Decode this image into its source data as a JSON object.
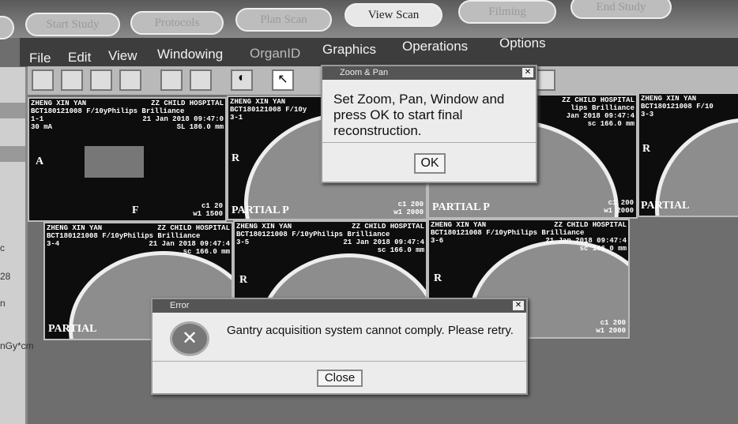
{
  "workflow": [
    "Start Study",
    "Protocols",
    "Plan Scan",
    "View Scan",
    "Filming",
    "End Study"
  ],
  "active_workflow": "View Scan",
  "menu": [
    "File",
    "Edit",
    "View",
    "Windowing",
    "OrganID",
    "Graphics",
    "Operations",
    "Options"
  ],
  "left_panel": [
    "c",
    "28",
    "n",
    "nGy*cm"
  ],
  "viewports": [
    {
      "name": "ZHENG XIN YAN",
      "hospital": "ZZ CHILD HOSPITAL",
      "id": "BCT180121008 F/10y",
      "scanner": "Philips Brilliance",
      "pos": "1-1",
      "date": "21 Jan 2018 09:47:0",
      "extra": "30 mA",
      "slice": "SL 186.0 mm",
      "left": "A",
      "bottom": "F",
      "wl": "c1 20",
      "ww": "w1 1500"
    },
    {
      "name": "ZHENG XIN YAN",
      "hospital": "",
      "id": "BCT180121008 F/10y",
      "scanner": "",
      "pos": "3-1",
      "date": "",
      "extra": "",
      "slice": "",
      "left": "R",
      "bottom": "PARTIAL   P",
      "wl": "c1 200",
      "ww": "w1 2000"
    },
    {
      "name": "",
      "hospital": "ZZ CHILD HOSPITAL",
      "id": "",
      "scanner": "lips Brilliance",
      "pos": "",
      "date": "Jan 2018 09:47:4",
      "extra": "",
      "slice": "sc 166.0 mm",
      "left": "",
      "bottom": "PARTIAL   P",
      "wl": "c1 200",
      "ww": "w1 2000"
    },
    {
      "name": "ZHENG XIN YAN",
      "hospital": "",
      "id": "BCT180121008 F/10",
      "scanner": "",
      "pos": "3-3",
      "date": "",
      "extra": "",
      "slice": "",
      "left": "R",
      "bottom": "PARTIAL",
      "wl": "",
      "ww": ""
    },
    {
      "name": "ZHENG XIN YAN",
      "hospital": "ZZ CHILD HOSPITAL",
      "id": "BCT180121008 F/10y",
      "scanner": "Philips Brilliance",
      "pos": "3-4",
      "date": "21 Jan 2018 09:47:4",
      "extra": "",
      "slice": "sc 166.0 mm",
      "left": "R",
      "bottom": "PARTIAL",
      "wl": "",
      "ww": ""
    },
    {
      "name": "ZHENG XIN YAN",
      "hospital": "ZZ CHILD HOSPITAL",
      "id": "BCT180121008 F/10y",
      "scanner": "Philips Brilliance",
      "pos": "3-5",
      "date": "21 Jan 2018 09:47:4",
      "extra": "",
      "slice": "sc 166.0 mm",
      "left": "R",
      "bottom": "",
      "wl": "",
      "ww": ""
    },
    {
      "name": "ZHENG XIN YAN",
      "hospital": "ZZ CHILD HOSPITAL",
      "id": "BCT180121008 F/10y",
      "scanner": "Philips Brilliance",
      "pos": "3-6",
      "date": "21 Jan 2018 09:47:4",
      "extra": "",
      "slice": "sc 166.0 mm",
      "left": "R",
      "bottom": "",
      "wl": "c1 200",
      "ww": "w1 2000"
    }
  ],
  "zoom_dialog": {
    "title": "Zoom & Pan",
    "message": "Set Zoom, Pan, Window and press OK to start final reconstruction.",
    "ok": "OK"
  },
  "error_dialog": {
    "title": "Error",
    "message": "Gantry acquisition system cannot comply. Please retry.",
    "close": "Close"
  }
}
